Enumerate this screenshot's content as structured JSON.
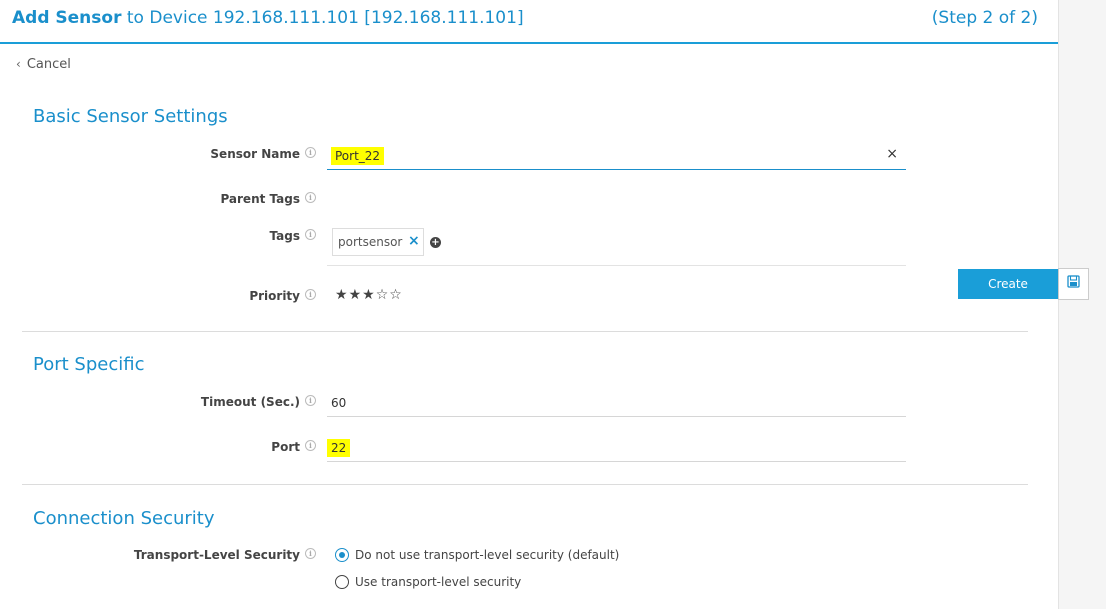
{
  "header": {
    "title_bold": "Add Sensor",
    "title_rest": " to Device 192.168.111.101 [192.168.111.101]",
    "step": "(Step 2 of 2)"
  },
  "nav": {
    "cancel_label": "Cancel"
  },
  "basic": {
    "title": "Basic Sensor Settings",
    "sensor_name_label": "Sensor Name",
    "sensor_name_value": "Port_22",
    "parent_tags_label": "Parent Tags",
    "tags_label": "Tags",
    "tags": [
      "portsensor"
    ],
    "priority_label": "Priority",
    "priority_value": 3,
    "priority_max": 5
  },
  "port": {
    "title": "Port Specific",
    "timeout_label": "Timeout (Sec.)",
    "timeout_value": "60",
    "port_label": "Port",
    "port_value": "22"
  },
  "security": {
    "title": "Connection Security",
    "tls_label": "Transport-Level Security",
    "options": [
      "Do not use transport-level security (default)",
      "Use transport-level security"
    ],
    "selected_index": 0
  },
  "actions": {
    "create_label": "Create"
  },
  "icons": {
    "info": "info-icon",
    "clear": "clear-icon",
    "tag_remove": "remove-tag-icon",
    "add_tag": "add-tag-icon",
    "star": "star-icon",
    "save": "save-icon",
    "chevron_left": "chevron-left-icon"
  },
  "colors": {
    "accent": "#1a9ed8",
    "highlight": "#ffff00"
  }
}
